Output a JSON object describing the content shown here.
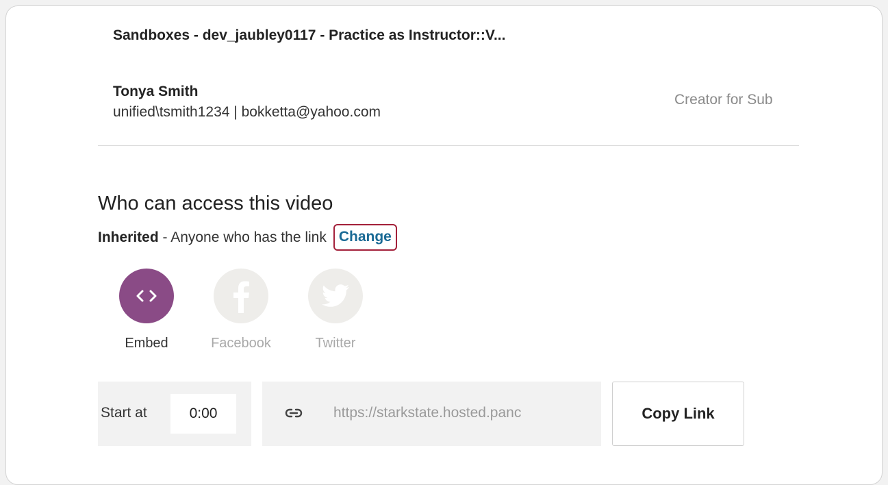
{
  "folder": {
    "title": "Sandboxes - dev_jaubley0117 - Practice as Instructor::V..."
  },
  "owner": {
    "name": "Tonya Smith",
    "details": "unified\\tsmith1234 | bokketta@yahoo.com",
    "role": "Creator for Sub"
  },
  "access": {
    "heading": "Who can access this video",
    "mode": "Inherited",
    "description": " - Anyone who has the link",
    "change_label": "Change",
    "highlight_color": "#a3203a",
    "link_color": "#1a6a95"
  },
  "share": {
    "options": [
      {
        "label": "Embed",
        "icon": "embed-code-icon",
        "state": "active",
        "color": "#8a4b86"
      },
      {
        "label": "Facebook",
        "icon": "facebook-icon",
        "state": "disabled"
      },
      {
        "label": "Twitter",
        "icon": "twitter-icon",
        "state": "disabled"
      }
    ]
  },
  "link": {
    "start_label": "Start at",
    "start_value": "0:00",
    "url": "https://starkstate.hosted.panc",
    "copy_label": "Copy Link"
  }
}
